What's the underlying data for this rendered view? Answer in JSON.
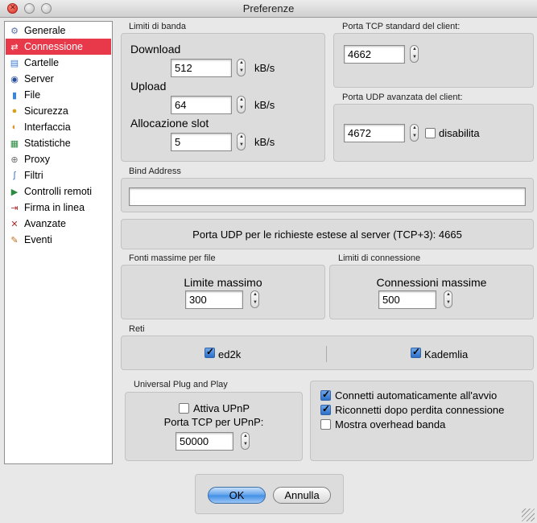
{
  "window": {
    "title": "Preferenze"
  },
  "sidebar": {
    "items": [
      {
        "label": "Generale",
        "icon": "gear-icon",
        "color": "#5a6fa8"
      },
      {
        "label": "Connessione",
        "icon": "connection-icon",
        "color": "#2e5fa8",
        "selected": true
      },
      {
        "label": "Cartelle",
        "icon": "folder-icon",
        "color": "#3b7bd1"
      },
      {
        "label": "Server",
        "icon": "server-icon",
        "color": "#2a4f99"
      },
      {
        "label": "File",
        "icon": "file-icon",
        "color": "#3b87d6"
      },
      {
        "label": "Sicurezza",
        "icon": "lock-icon",
        "color": "#d6a21e"
      },
      {
        "label": "Interfaccia",
        "icon": "palette-icon",
        "color": "#e0902a"
      },
      {
        "label": "Statistiche",
        "icon": "stats-icon",
        "color": "#2b8a3e"
      },
      {
        "label": "Proxy",
        "icon": "proxy-icon",
        "color": "#6b6b6b"
      },
      {
        "label": "Filtri",
        "icon": "filter-icon",
        "color": "#2f6fd0"
      },
      {
        "label": "Controlli remoti",
        "icon": "remote-icon",
        "color": "#2b8a3e"
      },
      {
        "label": "Firma in linea",
        "icon": "signpost-icon",
        "color": "#b03030"
      },
      {
        "label": "Avanzate",
        "icon": "tools-icon",
        "color": "#b02a2a"
      },
      {
        "label": "Eventi",
        "icon": "events-icon",
        "color": "#c26a1a"
      }
    ]
  },
  "bandwidth": {
    "title": "Limiti di banda",
    "download_label": "Download",
    "download_value": "512",
    "upload_label": "Upload",
    "upload_value": "64",
    "slot_label": "Allocazione slot",
    "slot_value": "5",
    "unit": "kB/s"
  },
  "tcp_port": {
    "title": "Porta TCP standard del client:",
    "value": "4662"
  },
  "udp_port": {
    "title": "Porta UDP avanzata del client:",
    "value": "4672",
    "disable_label": "disabilita",
    "disabled": false
  },
  "bind": {
    "title": "Bind Address",
    "value": ""
  },
  "udp_info": {
    "text": "Porta UDP per le richieste estese al server (TCP+3): 4665"
  },
  "sources": {
    "title": "Fonti massime per file",
    "label": "Limite massimo",
    "value": "300"
  },
  "connections": {
    "title": "Limiti di connessione",
    "label": "Connessioni massime",
    "value": "500"
  },
  "networks": {
    "title": "Reti",
    "ed2k_label": "ed2k",
    "ed2k": true,
    "kad_label": "Kademlia",
    "kad": true
  },
  "upnp": {
    "title": "Universal Plug and Play",
    "enable_label": "Attiva UPnP",
    "enabled": false,
    "port_label": "Porta TCP per UPnP:",
    "port_value": "50000"
  },
  "options": {
    "autoconnect_label": "Connetti automaticamente all'avvio",
    "autoconnect": true,
    "reconnect_label": "Riconnetti dopo perdita connessione",
    "reconnect": true,
    "overhead_label": "Mostra overhead banda",
    "overhead": false
  },
  "buttons": {
    "ok": "OK",
    "cancel": "Annulla"
  }
}
